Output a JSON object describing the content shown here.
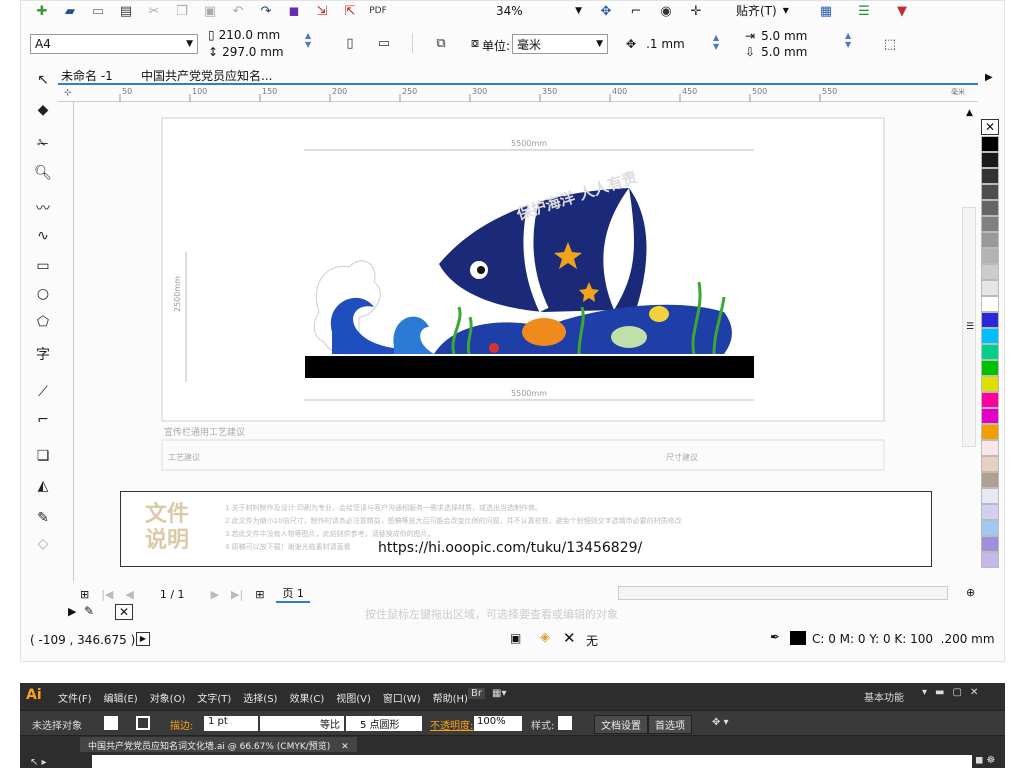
{
  "toolbar": {
    "zoom": "34%",
    "snap_label": "贴齐(T)",
    "page_size": "A4",
    "width": "210.0 mm",
    "height": "297.0 mm",
    "unit_label": "单位:",
    "unit": "毫米",
    "nudge": ".1 mm",
    "dup_x": "5.0 mm",
    "dup_y": "5.0 mm"
  },
  "tabs": [
    "未命名 -1",
    "中国共产党党员应知名..."
  ],
  "ruler_ticks": [
    "50",
    "100",
    "150",
    "200",
    "250",
    "300",
    "350",
    "400",
    "450",
    "500",
    "550"
  ],
  "ruler_unit": "毫米",
  "tool_labels": {
    "text_tool": "字"
  },
  "design": {
    "width_dim": "5500mm",
    "height_dim": "2500mm",
    "slogan": "保护海洋 人人有责",
    "process_title": "宣传栏通用工艺建议",
    "process_left": "工艺建议",
    "process_right": "尺寸建议"
  },
  "doc_note": {
    "title_line1": "文件",
    "title_line2": "说明",
    "lines": [
      "1.关于材料制作及设计:印刷为专业，会给您请与客户沟通相服务一需求选择材质，或选出当选制作商。",
      "2.此文件为缩小10倍尺寸，制作时请务必注意精益，图稿等放大后可能会改变比例的问题，并不认真校核，避免个别细则交字选城市必要的材质修改",
      "3.若此文件中没有人物等图片，此刻则供参考，请替换成你的图片。",
      "4.原稿可以放下载！谢谢光临素材请直看"
    ],
    "url": "https://hi.ooopic.com/tuku/13456829/"
  },
  "page_nav": {
    "pages": "1 / 1",
    "page_tab": "页 1"
  },
  "hint_text": "按住鼠标左键拖出区域，可选择要查看或编辑的对象",
  "status": {
    "coords": "( -109 , 346.675 )",
    "fill_label": "无",
    "outline": "C: 0 M: 0 Y: 0 K: 100  .200 mm"
  },
  "palette": [
    "#000000",
    "#1a1a1a",
    "#333333",
    "#4d4d4d",
    "#666666",
    "#808080",
    "#999999",
    "#b3b3b3",
    "#cccccc",
    "#e6e6e6",
    "#ffffff",
    "#2b2bd6",
    "#00bfff",
    "#00d08a",
    "#00c000",
    "#e0e000",
    "#ff00a0",
    "#e000c8",
    "#f0a000",
    "#f7e7e7",
    "#e8d0c0",
    "#b0a090",
    "#e8e8f4",
    "#d0d0f0",
    "#a0c8f0",
    "#a090e0",
    "#c8b8e8"
  ],
  "illustrator": {
    "logo": "Ai",
    "menus": [
      "文件(F)",
      "编辑(E)",
      "对象(O)",
      "文字(T)",
      "选择(S)",
      "效果(C)",
      "视图(V)",
      "窗口(W)",
      "帮助(H)"
    ],
    "workspace": "基本功能",
    "no_selection": "未选择对象",
    "stroke_label": "描边:",
    "stroke_weight": "1 pt",
    "stroke_style": "等比",
    "brush": "5 点圆形",
    "opacity_label": "不透明度:",
    "opacity": "100%",
    "style_label": "样式:",
    "doc_setup": "文档设置",
    "prefs": "首选项",
    "doc_tab": "中国共产党党员应知名词文化墙.ai @ 66.67% (CMYK/预览)"
  }
}
